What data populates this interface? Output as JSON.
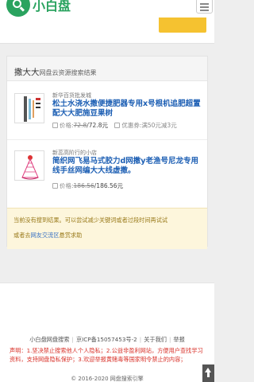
{
  "header": {
    "brand": "小白盘",
    "logo_icon": "search-icon",
    "menu_icon": "hamburger-menu-icon"
  },
  "panel": {
    "keyword": "撒大大",
    "title_suffix": "网盘云资源搜索结果"
  },
  "results": [
    {
      "shop": "新华百货批发城",
      "title": "松土水浇水撒便捷肥器专用x号根机追肥超置配大大肥施豆果树",
      "price_label": "价格:",
      "price_old": "72.8",
      "price_now": "/72.8元",
      "coupon_label": "优惠券:",
      "coupon_text": "满50元减3元"
    },
    {
      "shop": "新蕊高阶行的小店",
      "title": "简织网飞易马式胶力d网撒y老渔号尼龙专用线手丝网编大大线虚撒。",
      "price_label": "价格:",
      "price_old": "186.56",
      "price_now": "/186.56元"
    }
  ],
  "notice": {
    "line1": "当前没有搜到结果。可以尝试减少关键词或者过段时间再试试",
    "line2_prefix": "或者去",
    "line2_link": "网友交流区",
    "line2_suffix": "悬赏求助"
  },
  "footer": {
    "links": [
      "小白盘网盘搜索",
      "京ICP备15057453号-2",
      "关于我们",
      "举报"
    ],
    "warning": "声明：1.坚决禁止搜索他人个人隐私；2.公益非盈利网站，方便用户查找学习资料，支持网盘隐私保护；3.欢迎举报黄赌毒等国家明令禁止的内容；",
    "copyright": "© 2016-2020 网盘搜索引擎"
  },
  "colors": {
    "brand": "#2aa35f",
    "link": "#1d5fb4",
    "warning": "#d9332b",
    "accent_button": "#f5c230"
  }
}
